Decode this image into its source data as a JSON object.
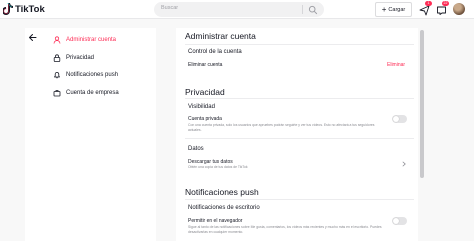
{
  "app": {
    "brand": "TikTok"
  },
  "header": {
    "search_placeholder": "Buscar",
    "upload_label": "Cargar",
    "messages_badge": "1",
    "inbox_badge": "22"
  },
  "sidebar": {
    "items": [
      {
        "label": "Administrar cuenta",
        "icon": "person-icon",
        "active": true
      },
      {
        "label": "Privacidad",
        "icon": "lock-icon",
        "active": false
      },
      {
        "label": "Notificaciones push",
        "icon": "bell-icon",
        "active": false
      },
      {
        "label": "Cuenta de empresa",
        "icon": "business-icon",
        "active": false
      }
    ]
  },
  "main": {
    "manage_account": {
      "title": "Administrar cuenta",
      "control_title": "Control de la cuenta",
      "delete_label": "Eliminar cuenta",
      "delete_action": "Eliminar"
    },
    "privacy": {
      "title": "Privacidad",
      "visibility_title": "Visibilidad",
      "private_label": "Cuenta privada",
      "private_desc": "Con una cuenta privada, solo los usuarios que apruebes podrán seguirte y ver tus vídeos. Esto no afectará a tus seguidores actuales.",
      "private_enabled": false,
      "data_title": "Datos",
      "download_label": "Descargar tus datos",
      "download_desc": "Obtén una copia de tus datos de TikTok"
    },
    "push": {
      "title": "Notificaciones push",
      "desktop_title": "Notificaciones de escritorio",
      "browser_label": "Permitir en el navegador",
      "browser_desc": "Sigue al tanto de las notificaciones sobre Me gusta, comentarios, los vídeos más recientes y mucho más en el escritorio. Puedes desactivarlas en cualquier momento.",
      "browser_enabled": false
    }
  },
  "colors": {
    "accent": "#fe2c55",
    "text": "#161823",
    "muted": "#8a8b91"
  }
}
